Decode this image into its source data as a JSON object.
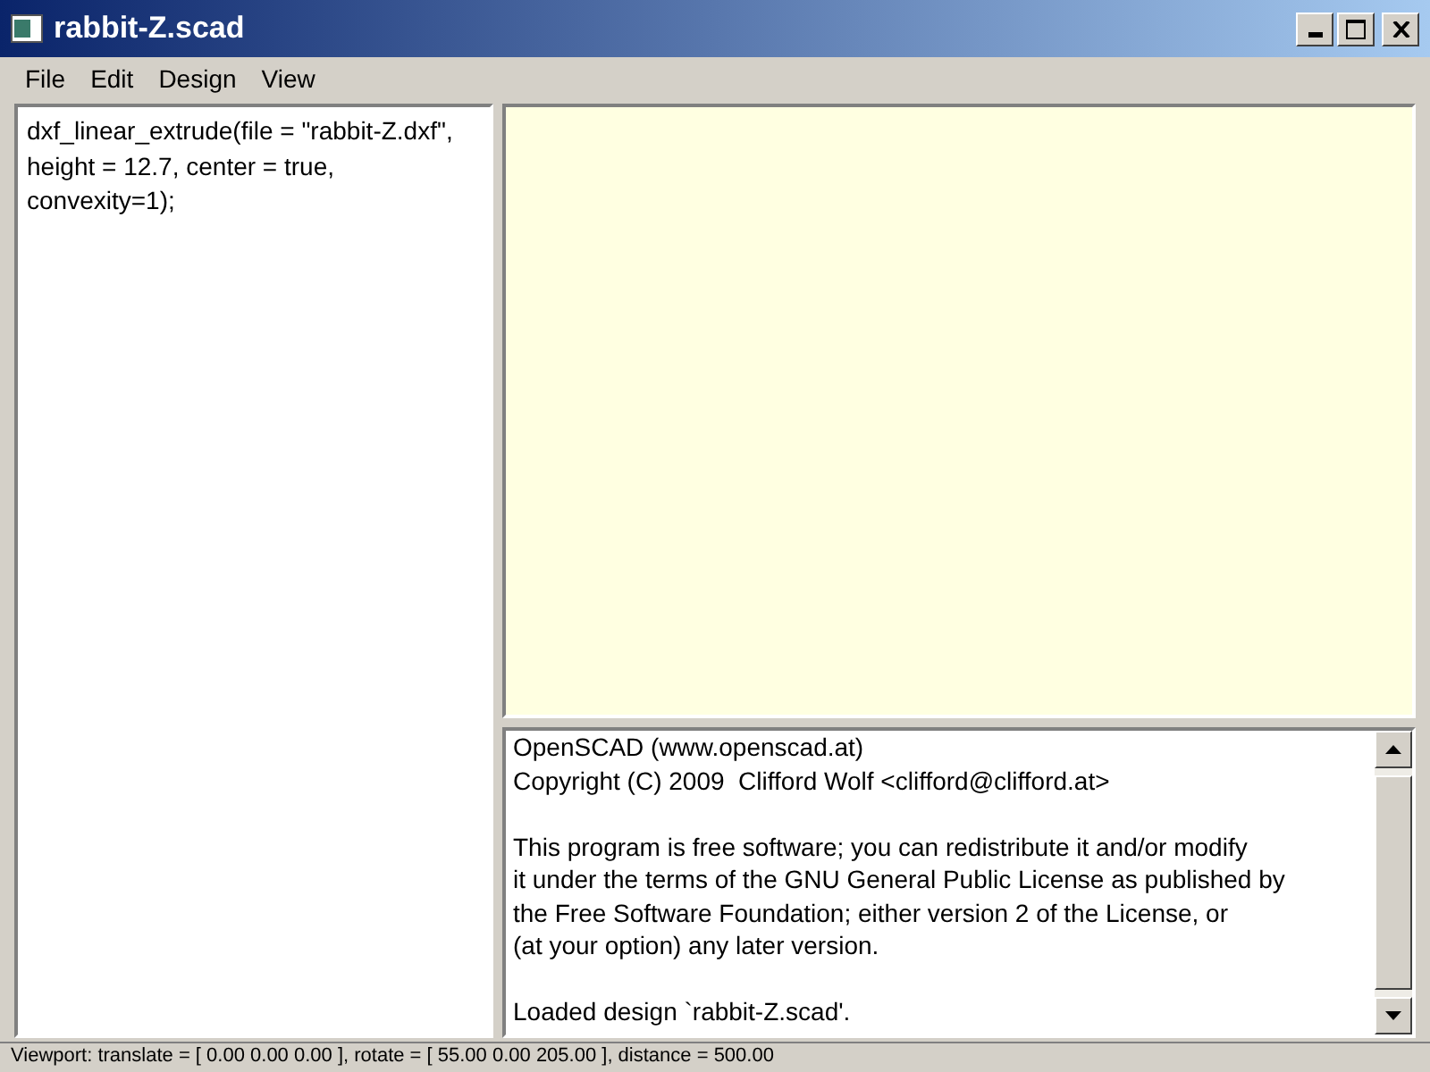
{
  "window": {
    "title": "rabbit-Z.scad"
  },
  "menu": [
    "File",
    "Edit",
    "Design",
    "View"
  ],
  "editor": {
    "value": "dxf_linear_extrude(file = \"rabbit-Z.dxf\", height = 12.7, center = true, convexity=1);"
  },
  "console": {
    "paragraphs": [
      [
        "OpenSCAD (www.openscad.at)",
        "Copyright (C) 2009  Clifford Wolf <clifford@clifford.at>"
      ],
      [
        "This program is free software; you can redistribute it and/or modify",
        "it under the terms of the GNU General Public License as published by",
        "the Free Software Foundation; either version 2 of the License, or",
        "(at your option) any later version."
      ],
      [
        "Loaded design `rabbit-Z.scad'."
      ]
    ]
  },
  "status_bar": "Viewport: translate = [ 0.00 0.00 0.00 ], rotate = [ 55.00 0.00 205.00 ], distance = 500.00"
}
